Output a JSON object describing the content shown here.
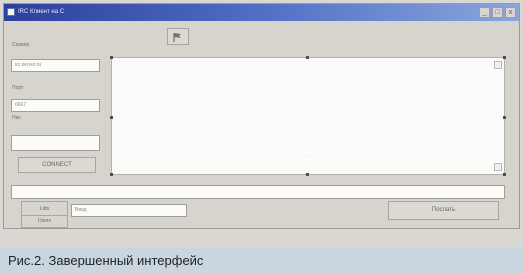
{
  "window": {
    "title": "IRC Клиент на C",
    "controls": [
      "_",
      "□",
      "x"
    ]
  },
  "top_tool": {
    "icon": "flag-icon"
  },
  "left_panel": {
    "server_label": "Сервер",
    "server_value": "irc.server.ru",
    "port_label": "Порт",
    "port_value": "6667",
    "nick_label": "Ник",
    "nick_value": "",
    "connect_button": "CONNECT"
  },
  "main": {
    "output_marker": "· · ·"
  },
  "bottom": {
    "message_input": "",
    "tabs": [
      "Lids",
      "Users"
    ],
    "channel_value": "Ввод",
    "send_button": "Послать"
  },
  "caption": "Рис.2. Завершенный интерфейс"
}
